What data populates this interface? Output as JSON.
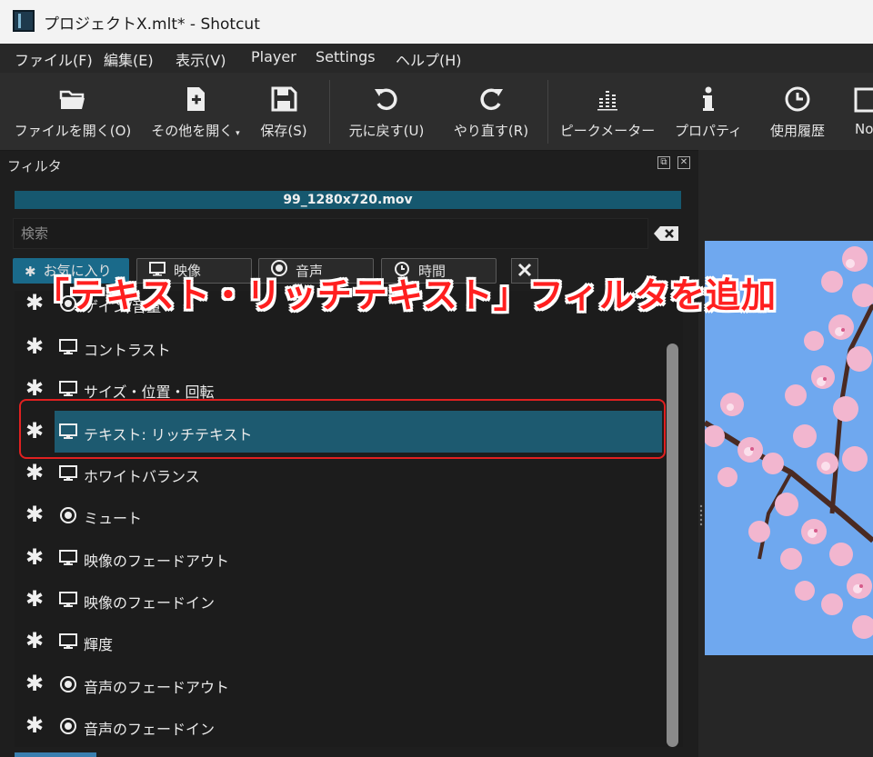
{
  "window": {
    "title": "プロジェクトX.mlt* - Shotcut"
  },
  "menu": [
    "ファイル(F)",
    "編集(E)",
    "表示(V)",
    "Player",
    "Settings",
    "ヘルプ(H)"
  ],
  "toolbar": {
    "open_file": "ファイルを開く(O)",
    "open_other": "その他を開く",
    "save": "保存(S)",
    "undo": "元に戻す(U)",
    "redo": "やり直す(R)",
    "peak_meter": "ピークメーター",
    "properties": "プロパティ",
    "history": "使用履歴",
    "notes_partial": "No"
  },
  "filters_panel": {
    "title": "フィルタ",
    "clip_name": "99_1280x720.mov",
    "search_placeholder": "検索",
    "tabs": [
      {
        "label": "お気に入り",
        "icon": "star-icon"
      },
      {
        "label": "映像",
        "icon": "monitor-icon"
      },
      {
        "label": "音声",
        "icon": "audio-icon"
      },
      {
        "label": "時間",
        "icon": "clock-icon"
      }
    ],
    "items": [
      {
        "label": "ゲイン/音量",
        "icon": "audio-icon"
      },
      {
        "label": "コントラスト",
        "icon": "monitor-icon"
      },
      {
        "label": "サイズ・位置・回転",
        "icon": "monitor-icon"
      },
      {
        "label": "テキスト: リッチテキスト",
        "icon": "monitor-icon",
        "selected": true
      },
      {
        "label": "ホワイトバランス",
        "icon": "monitor-icon"
      },
      {
        "label": "ミュート",
        "icon": "audio-icon"
      },
      {
        "label": "映像のフェードアウト",
        "icon": "monitor-icon"
      },
      {
        "label": "映像のフェードイン",
        "icon": "monitor-icon"
      },
      {
        "label": "輝度",
        "icon": "monitor-icon"
      },
      {
        "label": "音声のフェードアウト",
        "icon": "audio-icon"
      },
      {
        "label": "音声のフェードイン",
        "icon": "audio-icon"
      }
    ]
  },
  "annotation": {
    "text": "「テキスト・リッチテキスト」フィルタを追加",
    "color": "#ff1f1f"
  },
  "colors": {
    "accent": "#1d5a70",
    "tab_active": "#1a6a8a",
    "highlight": "#e02020",
    "sky": "#6fa8ef",
    "blossom": "#f2b6cf"
  }
}
